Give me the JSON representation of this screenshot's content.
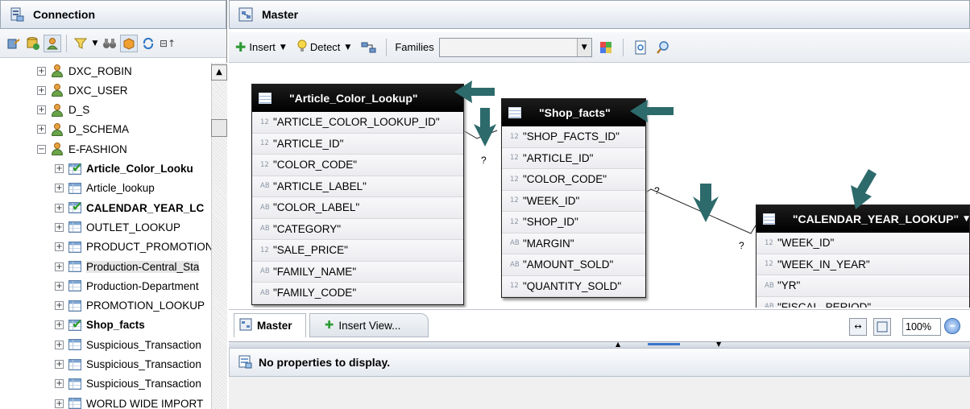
{
  "connection_pane": {
    "title": "Connection",
    "tree": [
      {
        "label": "DXC_ROBIN",
        "type": "user",
        "expander": "+",
        "bold": false
      },
      {
        "label": "DXC_USER",
        "type": "user",
        "expander": "+",
        "bold": false
      },
      {
        "label": "D_S",
        "type": "user",
        "expander": "+",
        "bold": false
      },
      {
        "label": "D_SCHEMA",
        "type": "user",
        "expander": "+",
        "bold": false
      },
      {
        "label": "E-FASHION",
        "type": "user",
        "expander": "−",
        "bold": false
      },
      {
        "label": "Article_Color_Looku",
        "type": "table-checked",
        "expander": "+",
        "bold": true
      },
      {
        "label": "Article_lookup",
        "type": "table",
        "expander": "+",
        "bold": false
      },
      {
        "label": "CALENDAR_YEAR_LC",
        "type": "table-checked",
        "expander": "+",
        "bold": true
      },
      {
        "label": "OUTLET_LOOKUP",
        "type": "table",
        "expander": "+",
        "bold": false
      },
      {
        "label": "PRODUCT_PROMOTION",
        "type": "table",
        "expander": "+",
        "bold": false
      },
      {
        "label": "Production-Central_Sta",
        "type": "table",
        "expander": "+",
        "bold": false,
        "highlight": true
      },
      {
        "label": "Production-Department",
        "type": "table",
        "expander": "+",
        "bold": false
      },
      {
        "label": "PROMOTION_LOOKUP",
        "type": "table",
        "expander": "+",
        "bold": false
      },
      {
        "label": "Shop_facts",
        "type": "table-checked",
        "expander": "+",
        "bold": true
      },
      {
        "label": "Suspicious_Transaction",
        "type": "table",
        "expander": "+",
        "bold": false
      },
      {
        "label": "Suspicious_Transaction",
        "type": "table",
        "expander": "+",
        "bold": false
      },
      {
        "label": "Suspicious_Transaction",
        "type": "table",
        "expander": "+",
        "bold": false
      },
      {
        "label": "WORLD WIDE IMPORT",
        "type": "table",
        "expander": "+",
        "bold": false
      }
    ]
  },
  "master_pane": {
    "title": "Master",
    "toolbar": {
      "insert_label": "Insert",
      "detect_label": "Detect",
      "families_label": "Families",
      "families_value": ""
    },
    "tables": [
      {
        "name": "\"Article_Color_Lookup\"",
        "columns": [
          {
            "type": "12",
            "name": "\"ARTICLE_COLOR_LOOKUP_ID\""
          },
          {
            "type": "12",
            "name": "\"ARTICLE_ID\""
          },
          {
            "type": "12",
            "name": "\"COLOR_CODE\""
          },
          {
            "type": "AB",
            "name": "\"ARTICLE_LABEL\""
          },
          {
            "type": "AB",
            "name": "\"COLOR_LABEL\""
          },
          {
            "type": "AB",
            "name": "\"CATEGORY\""
          },
          {
            "type": "12",
            "name": "\"SALE_PRICE\""
          },
          {
            "type": "AB",
            "name": "\"FAMILY_NAME\""
          },
          {
            "type": "AB",
            "name": "\"FAMILY_CODE\""
          }
        ]
      },
      {
        "name": "\"Shop_facts\"",
        "columns": [
          {
            "type": "12",
            "name": "\"SHOP_FACTS_ID\""
          },
          {
            "type": "12",
            "name": "\"ARTICLE_ID\""
          },
          {
            "type": "12",
            "name": "\"COLOR_CODE\""
          },
          {
            "type": "12",
            "name": "\"WEEK_ID\""
          },
          {
            "type": "12",
            "name": "\"SHOP_ID\""
          },
          {
            "type": "AB",
            "name": "\"MARGIN\""
          },
          {
            "type": "AB",
            "name": "\"AMOUNT_SOLD\""
          },
          {
            "type": "12",
            "name": "\"QUANTITY_SOLD\""
          }
        ]
      },
      {
        "name": "\"CALENDAR_YEAR_LOOKUP\"",
        "columns": [
          {
            "type": "12",
            "name": "\"WEEK_ID\""
          },
          {
            "type": "12",
            "name": "\"WEEK_IN_YEAR\""
          },
          {
            "type": "AB",
            "name": "\"YR\""
          },
          {
            "type": "AB",
            "name": "\"FISCAL_PERIOD\""
          }
        ]
      }
    ],
    "join_marker": "?",
    "tabs": {
      "master": "Master",
      "insert_view": "Insert View..."
    },
    "zoom": "100%"
  },
  "properties": {
    "message": "No properties to display."
  },
  "colors": {
    "annotation_arrow": "#2d6a6b",
    "table_header": "#000000"
  }
}
